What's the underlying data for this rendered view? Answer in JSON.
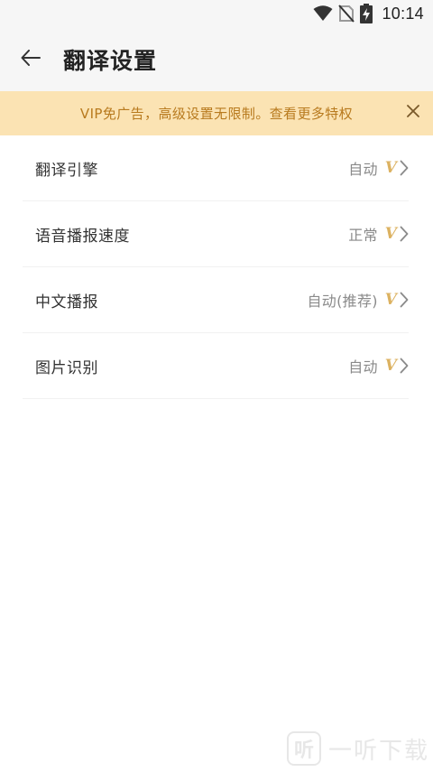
{
  "status_bar": {
    "time": "10:14",
    "icons": [
      "wifi-icon",
      "no-sim-icon",
      "battery-charging-icon"
    ]
  },
  "header": {
    "back_icon": "arrow-left-icon",
    "title": "翻译设置"
  },
  "vip_banner": {
    "text": "VIP免广告，高级设置无限制。查看更多特权",
    "close_icon": "close-icon",
    "colors": {
      "background": "#fbe3b3",
      "text": "#b87a1e"
    }
  },
  "settings": {
    "items": [
      {
        "label": "翻译引擎",
        "value": "自动",
        "vip_badge": "V"
      },
      {
        "label": "语音播报速度",
        "value": "正常",
        "vip_badge": "V"
      },
      {
        "label": "中文播报",
        "value": "自动(推荐)",
        "vip_badge": "V"
      },
      {
        "label": "图片识别",
        "value": "自动",
        "vip_badge": "V"
      }
    ],
    "vip_color": "#dcb261"
  },
  "watermark": {
    "logo_char": "听",
    "text": "一听下载"
  }
}
